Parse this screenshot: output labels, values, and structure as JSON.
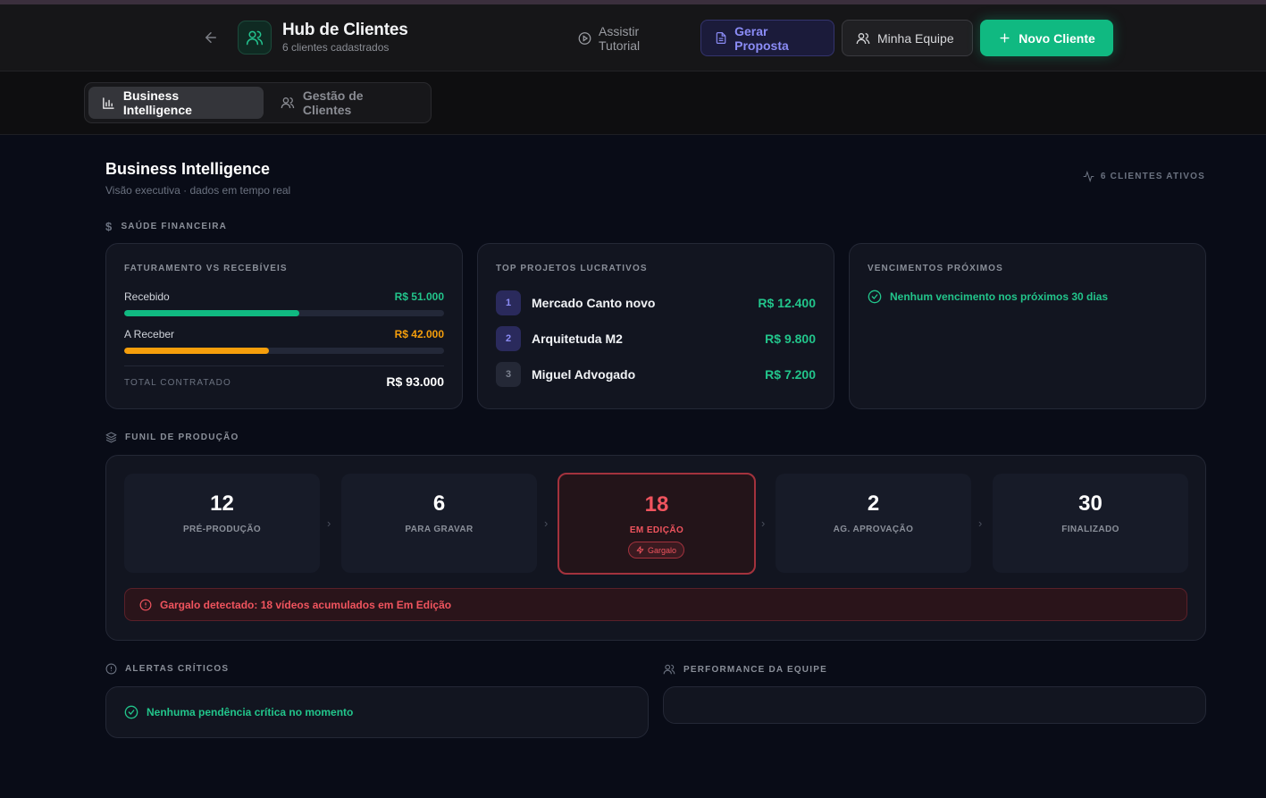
{
  "header": {
    "title": "Hub de Clientes",
    "subtitle": "6 clientes cadastrados",
    "buttons": {
      "tutorial": "Assistir Tutorial",
      "proposta": "Gerar Proposta",
      "equipe": "Minha Equipe",
      "novo_cliente": "Novo Cliente"
    }
  },
  "tabs": {
    "bi": "Business Intelligence",
    "gestao": "Gestão de Clientes"
  },
  "main": {
    "title": "Business Intelligence",
    "subtitle": "Visão executiva · dados em tempo real",
    "active_clients": "6 CLIENTES ATIVOS"
  },
  "saude": {
    "label": "SAÚDE FINANCEIRA",
    "faturamento": {
      "label": "FATURAMENTO VS RECEBÍVEIS",
      "recebido_label": "Recebido",
      "recebido_value": "R$ 51.000",
      "recebido_fraction": 0.548,
      "a_receber_label": "A Receber",
      "a_receber_value": "R$ 42.000",
      "a_receber_fraction": 0.452,
      "total_label": "TOTAL CONTRATADO",
      "total_value": "R$ 93.000"
    },
    "top_projetos": {
      "label": "TOP PROJETOS LUCRATIVOS",
      "items": [
        {
          "rank": "1",
          "name": "Mercado Canto novo",
          "value": "R$ 12.400"
        },
        {
          "rank": "2",
          "name": "Arquitetuda M2",
          "value": "R$ 9.800"
        },
        {
          "rank": "3",
          "name": "Miguel Advogado",
          "value": "R$ 7.200"
        }
      ]
    },
    "vencimentos": {
      "label": "VENCIMENTOS PRÓXIMOS",
      "message": "Nenhum vencimento nos próximos 30 dias"
    }
  },
  "funil": {
    "label": "FUNIL DE PRODUÇÃO",
    "stages": [
      {
        "count": "12",
        "label": "PRÉ-PRODUÇÃO"
      },
      {
        "count": "6",
        "label": "PARA GRAVAR"
      },
      {
        "count": "18",
        "label": "EM EDIÇÃO",
        "badge": "Gargalo"
      },
      {
        "count": "2",
        "label": "AG. APROVAÇÃO"
      },
      {
        "count": "30",
        "label": "FINALIZADO"
      }
    ],
    "alert": "Gargalo detectado: 18 vídeos acumulados em Em Edição"
  },
  "alertas": {
    "label": "ALERTAS CRÍTICOS",
    "message": "Nenhuma pendência crítica no momento"
  },
  "performance": {
    "label": "PERFORMANCE DA EQUIPE"
  },
  "colors": {
    "accent_green": "#10b981",
    "accent_purple": "#8b8cf6",
    "warning_orange": "#f59e0b",
    "danger_red": "#f0545e"
  }
}
